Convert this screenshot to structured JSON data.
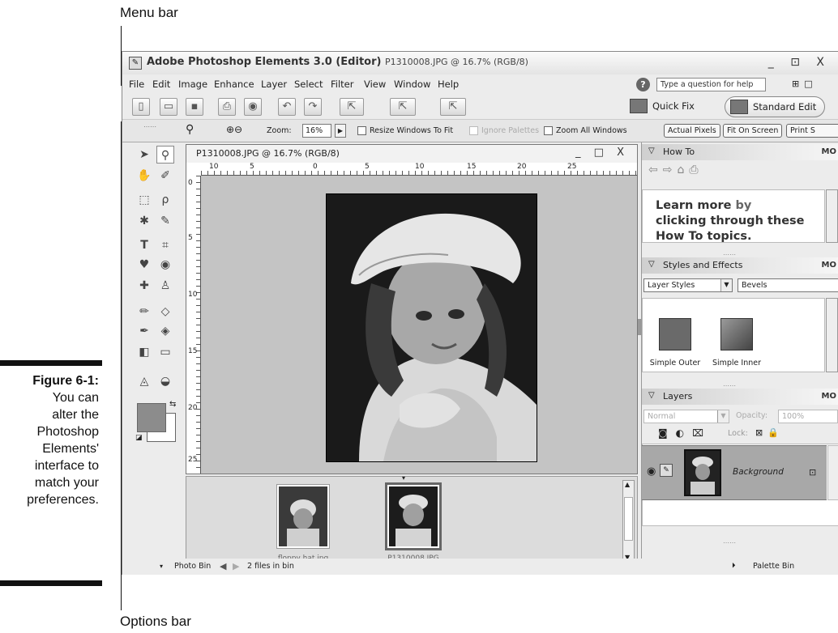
{
  "callouts": {
    "menu_bar": "Menu bar",
    "options_bar": "Options bar"
  },
  "figure": {
    "number": "Figure 6-1:",
    "caption_lines": [
      "You can",
      "alter the",
      "Photoshop",
      "Elements'",
      "interface to",
      "match your",
      "preferences."
    ]
  },
  "window": {
    "app_name": "Adobe Photoshop Elements 3.0 (Editor)",
    "doc_info": "P1310008.JPG @ 16.7% (RGB/8)",
    "controls": "_ ⊡ X"
  },
  "menu": {
    "items": [
      "File",
      "Edit",
      "Image",
      "Enhance",
      "Layer",
      "Select",
      "Filter",
      "View",
      "Window",
      "Help"
    ],
    "help_placeholder": "Type a question for help"
  },
  "modes": {
    "quick_fix": "Quick Fix",
    "standard_edit": "Standard Edit"
  },
  "options": {
    "zoom_label": "Zoom:",
    "zoom_value": "16%",
    "resize_windows": "Resize Windows To Fit",
    "ignore_palettes": "Ignore Palettes",
    "zoom_all_windows": "Zoom All Windows",
    "actual_pixels": "Actual Pixels",
    "fit_on_screen": "Fit On Screen",
    "print_size": "Print S"
  },
  "document": {
    "title": "P1310008.JPG @ 16.7% (RGB/8)",
    "controls": "_ □ X",
    "ruler_h": [
      "10",
      "5",
      "0",
      "5",
      "10",
      "15",
      "20",
      "25"
    ],
    "ruler_v": [
      "0",
      "5",
      "10",
      "15",
      "20",
      "25"
    ]
  },
  "photo_bin": {
    "thumbs": [
      {
        "caption": "floppy hat.jpg"
      },
      {
        "caption": "P1310008.JPG"
      }
    ],
    "status_label": "Photo Bin",
    "status_count": "2 files in bin",
    "palette_bin_label": "Palette Bin"
  },
  "palettes": {
    "how_to": {
      "title": "How To",
      "more": "MO",
      "text_a": "Learn more",
      "text_b": " by",
      "text_c": "clicking through these",
      "text_d": "How To topics."
    },
    "styles": {
      "title": "Styles and Effects",
      "more": "MO",
      "category": "Layer Styles",
      "library": "Bevels",
      "items": [
        "Simple Outer",
        "Simple Inner"
      ]
    },
    "layers": {
      "title": "Layers",
      "more": "MO",
      "blend_mode": "Normal",
      "opacity_label": "Opacity:",
      "opacity_value": "100%",
      "lock_label": "Lock:",
      "layer_name": "Background"
    }
  },
  "colors": {
    "background_layer_row": "#a8a8a8",
    "foreground_swatch": "#8c8c8c"
  }
}
